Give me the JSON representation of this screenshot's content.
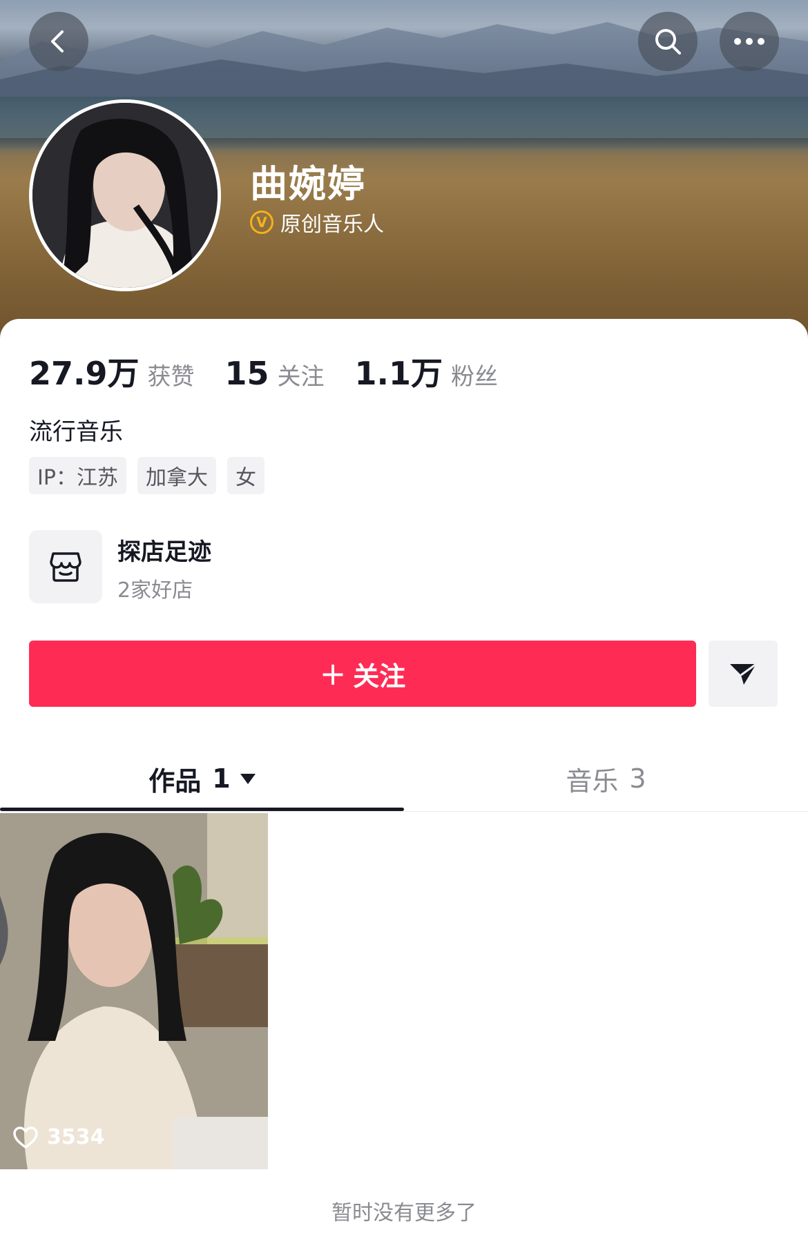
{
  "profile": {
    "name": "曲婉婷",
    "verify_badge": "V",
    "verify_text": "原创音乐人",
    "bio": "流行音乐"
  },
  "stats": [
    {
      "value": "27.9万",
      "label": "获赞"
    },
    {
      "value": "15",
      "label": "关注"
    },
    {
      "value": "1.1万",
      "label": "粉丝"
    }
  ],
  "tags": [
    "IP：江苏",
    "加拿大",
    "女"
  ],
  "shop": {
    "icon": "store-icon",
    "title": "探店足迹",
    "subtitle": "2家好店"
  },
  "actions": {
    "follow_plus": "+",
    "follow_label": "关注",
    "share_icon": "send-icon"
  },
  "tabs": {
    "works_label": "作品",
    "works_count": "1",
    "music_label": "音乐",
    "music_count": "3"
  },
  "videos": [
    {
      "likes": "3534"
    }
  ],
  "footer": "暂时没有更多了",
  "icons": {
    "back": "chevron-left-icon",
    "search": "search-icon",
    "more": "more-horizontal-icon",
    "like": "heart-icon"
  },
  "colors": {
    "accent": "#fe2c55",
    "badge": "#f6b21a"
  }
}
